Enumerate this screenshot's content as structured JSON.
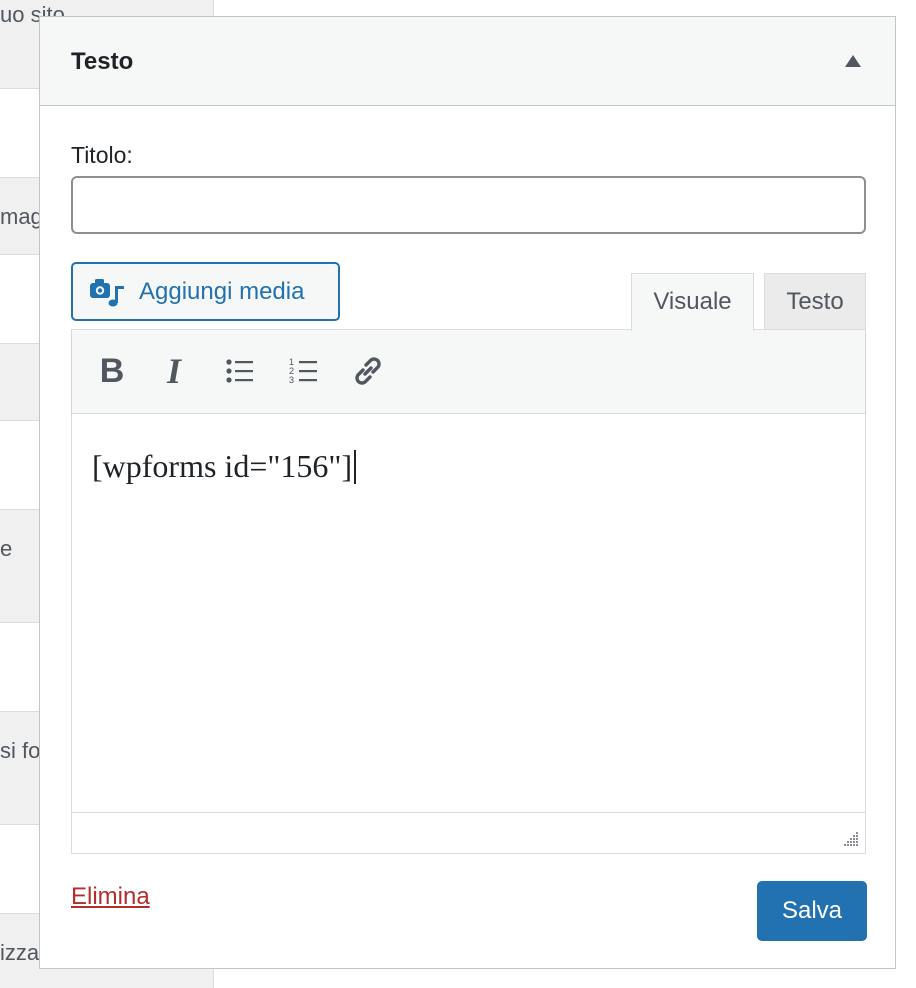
{
  "background_list": {
    "fragments": [
      "uo sito",
      "mag",
      "e",
      "si fo",
      "izza"
    ]
  },
  "widget": {
    "title": "Testo",
    "title_label": "Titolo:",
    "title_value": "",
    "add_media_label": "Aggiungi media",
    "tabs": [
      {
        "label": "Visuale",
        "active": true
      },
      {
        "label": "Testo",
        "active": false
      }
    ],
    "toolbar": {
      "bold_label": "B",
      "italic_label": "I"
    },
    "content": "[wpforms id=\"156\"]",
    "delete_label": "Elimina",
    "save_label": "Salva"
  },
  "colors": {
    "accent": "#2271b1",
    "danger": "#b32d2e",
    "icon": "#50575e"
  },
  "icons": [
    "chevron-up-icon",
    "media-icon",
    "bold-icon",
    "italic-icon",
    "bullet-list-icon",
    "numbered-list-icon",
    "link-icon",
    "resize-handle-icon"
  ]
}
